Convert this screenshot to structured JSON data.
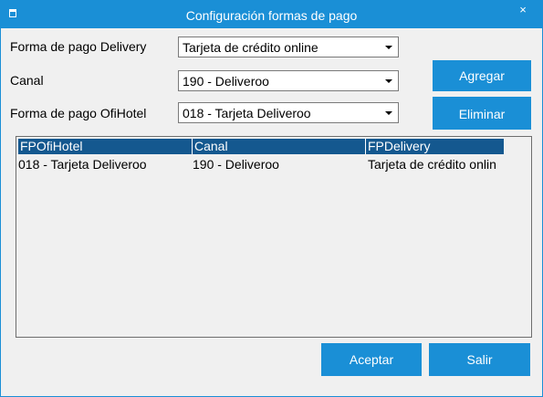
{
  "window": {
    "title": "Configuración formas de pago",
    "close_glyph": "×"
  },
  "form": {
    "delivery_label": "Forma de pago Delivery",
    "delivery_value": "Tarjeta de crédito online",
    "canal_label": "Canal",
    "canal_value": "190 - Deliveroo",
    "ofihotel_label": "Forma de pago OfiHotel",
    "ofihotel_value": "018 - Tarjeta Deliveroo"
  },
  "buttons": {
    "agregar": "Agregar",
    "eliminar": "Eliminar",
    "aceptar": "Aceptar",
    "salir": "Salir"
  },
  "table": {
    "columns": [
      "FPOfiHotel",
      "Canal",
      "FPDelivery"
    ],
    "rows": [
      [
        "018 - Tarjeta Deliveroo",
        "190 - Deliveroo",
        "Tarjeta de crédito onlin"
      ]
    ]
  },
  "colors": {
    "accent": "#1a8fd6",
    "header": "#14588f",
    "background": "#f0f0f0"
  },
  "icons": {
    "app": "app-icon",
    "close": "close-icon",
    "dropdown": "chevron-down-icon"
  }
}
